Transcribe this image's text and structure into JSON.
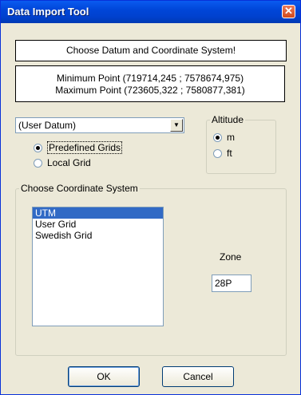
{
  "window": {
    "title": "Data Import Tool"
  },
  "header_panel": {
    "text": "Choose Datum and Coordinate System!"
  },
  "points_panel": {
    "min_point": "Minimum Point (719714,245 ; 7578674,975)",
    "max_point": "Maximum Point (723605,322 ; 7580877,381)"
  },
  "datum_select": {
    "value": "(User Datum)"
  },
  "grid_options": [
    {
      "label": "Predefined Grids",
      "selected": true
    },
    {
      "label": "Local Grid",
      "selected": false
    }
  ],
  "altitude": {
    "label": "Altitude",
    "options": [
      {
        "label": "m",
        "selected": true
      },
      {
        "label": "ft",
        "selected": false
      }
    ]
  },
  "coord_system": {
    "label": "Choose Coordinate System",
    "items": [
      "UTM",
      "User Grid",
      "Swedish Grid"
    ],
    "selected": "UTM"
  },
  "zone": {
    "label": "Zone",
    "value": "28P"
  },
  "buttons": {
    "ok": "OK",
    "cancel": "Cancel"
  },
  "colors": {
    "titlebar": "#0046d8",
    "selection": "#316ac5",
    "face": "#ece9d8"
  }
}
